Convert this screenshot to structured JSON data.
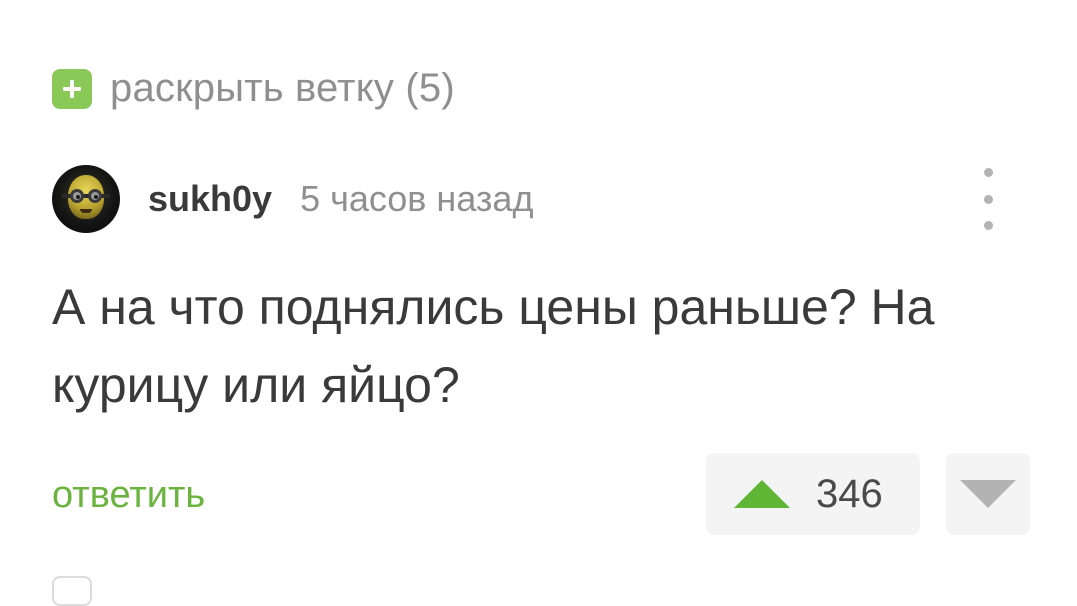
{
  "thread": {
    "expand_label": "раскрыть ветку (5)",
    "accent_color": "#8ac858"
  },
  "comment": {
    "author": "sukh0y",
    "time": "5 часов назад",
    "text": "А на что поднялись цены раньше? На курицу или яйцо?",
    "reply_label": "ответить",
    "rating": "346"
  },
  "icons": {
    "expand": "plus-square-icon",
    "menu": "more-vertical-icon",
    "upvote": "triangle-up-icon",
    "downvote": "triangle-down-icon"
  },
  "colors": {
    "upvote": "#5fb534",
    "reply": "#6bb33f",
    "muted": "#8f8f8f"
  }
}
